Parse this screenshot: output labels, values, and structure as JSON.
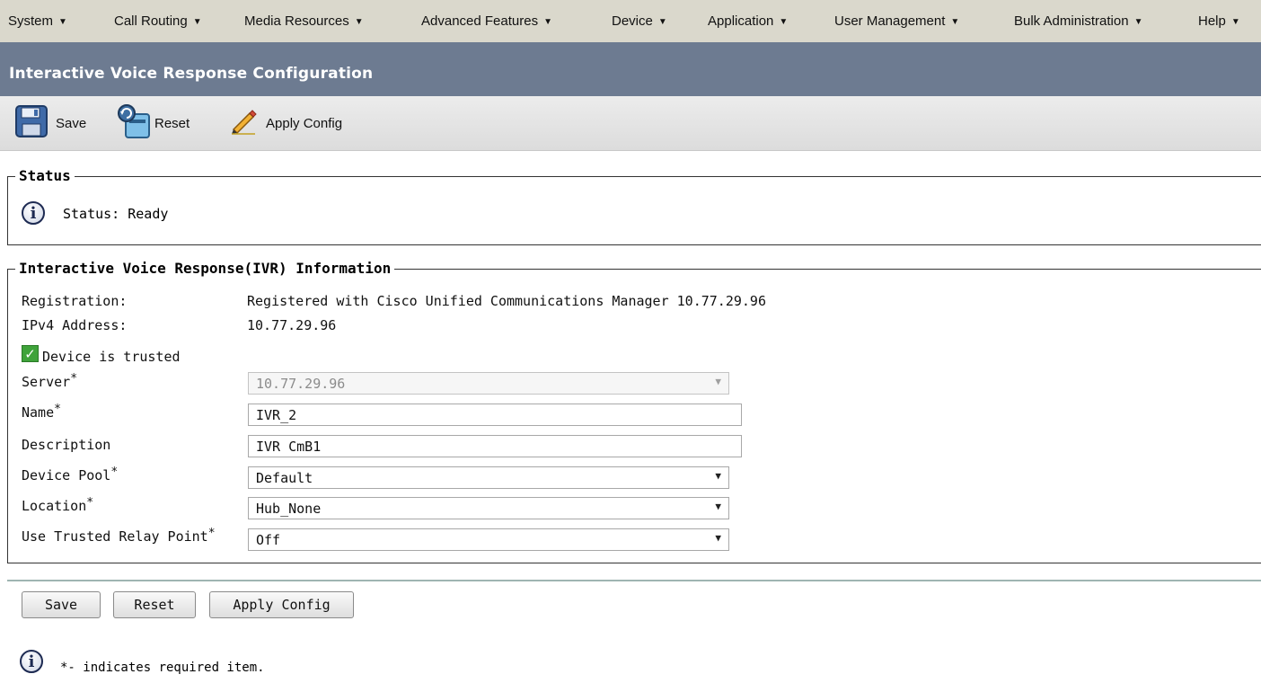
{
  "menubar": {
    "items": [
      {
        "label": "System"
      },
      {
        "label": "Call Routing"
      },
      {
        "label": "Media Resources"
      },
      {
        "label": "Advanced Features"
      },
      {
        "label": "Device"
      },
      {
        "label": "Application"
      },
      {
        "label": "User Management"
      },
      {
        "label": "Bulk Administration"
      },
      {
        "label": "Help"
      }
    ]
  },
  "header": {
    "title": "Interactive Voice Response Configuration"
  },
  "toolbar": {
    "save_label": "Save",
    "reset_label": "Reset",
    "apply_label": "Apply Config",
    "icons": {
      "save": "floppy-disk-icon",
      "reset": "reset-icon",
      "apply": "pencil-icon"
    }
  },
  "status": {
    "legend": "Status",
    "text": "Status: Ready",
    "icon": "info-icon"
  },
  "ivr": {
    "legend": "Interactive Voice Response(IVR) Information",
    "registration_label": "Registration:",
    "registration_value": "Registered with Cisco Unified Communications Manager 10.77.29.96",
    "ipv4_label": "IPv4 Address:",
    "ipv4_value": "10.77.29.96",
    "trusted_label": "Device is trusted",
    "trusted_checked": true,
    "server_label": "Server",
    "server_value": "10.77.29.96",
    "name_label": "Name",
    "name_value": "IVR_2",
    "description_label": "Description",
    "description_value": "IVR CmB1",
    "device_pool_label": "Device Pool",
    "device_pool_value": "Default",
    "location_label": "Location",
    "location_value": "Hub_None",
    "relay_label": "Use Trusted Relay Point",
    "relay_value": "Off",
    "required_mark": "*"
  },
  "bottom": {
    "save_label": "Save",
    "reset_label": "Reset",
    "apply_label": "Apply Config"
  },
  "footer": {
    "note": "*- indicates required item."
  },
  "colors": {
    "menubar_bg": "#dad8cc",
    "titlebar_bg": "#6d7b91",
    "toolbar_bg": "#e4e4e4",
    "checkbox_green": "#3fa33a"
  }
}
